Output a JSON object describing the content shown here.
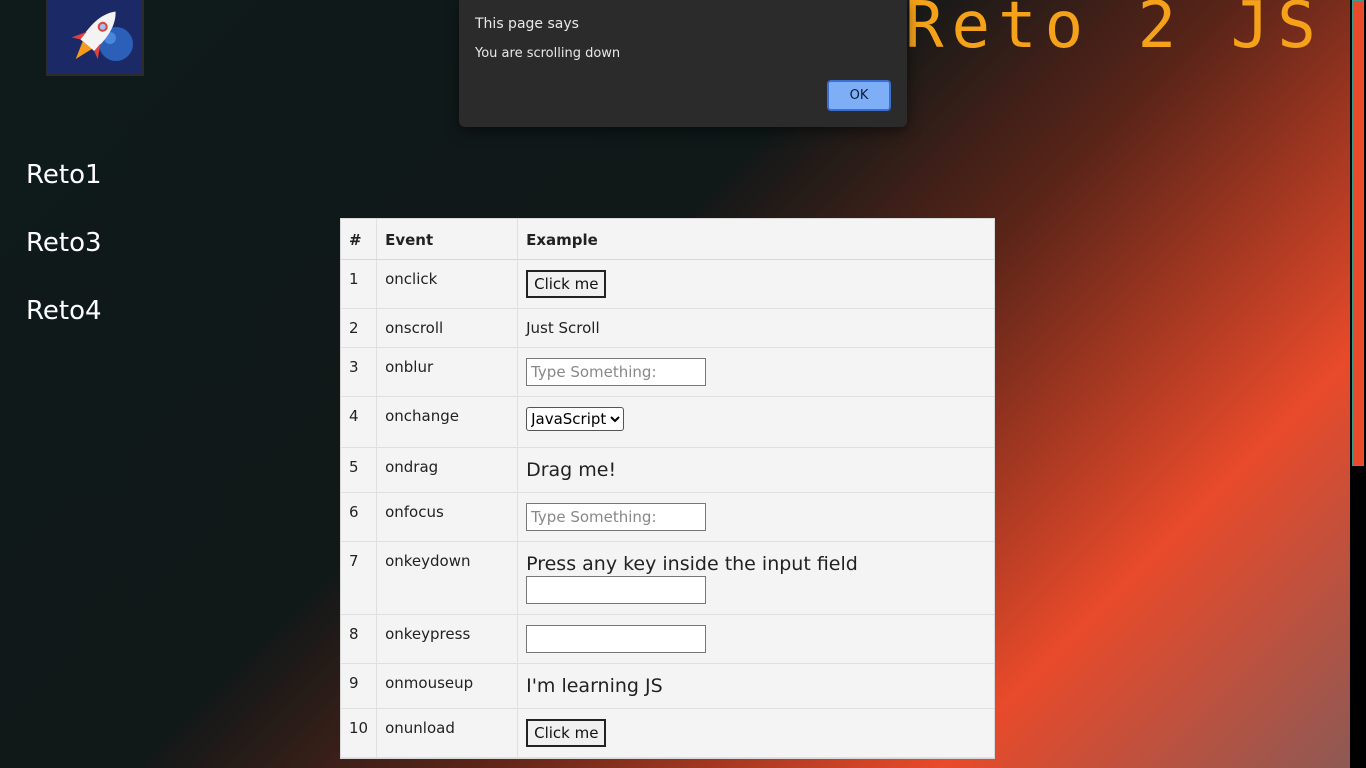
{
  "site": {
    "title": "Reto 2 JS"
  },
  "nav": {
    "items": [
      {
        "label": "Reto1"
      },
      {
        "label": "Reto3"
      },
      {
        "label": "Reto4"
      }
    ]
  },
  "table": {
    "headers": [
      "#",
      "Event",
      "Example"
    ],
    "rows": [
      {
        "n": "1",
        "event": "onclick",
        "button": "Click me"
      },
      {
        "n": "2",
        "event": "onscroll",
        "text": "Just Scroll"
      },
      {
        "n": "3",
        "event": "onblur",
        "placeholder": "Type Something:"
      },
      {
        "n": "4",
        "event": "onchange",
        "select": "JavaScript"
      },
      {
        "n": "5",
        "event": "ondrag",
        "text": "Drag me!"
      },
      {
        "n": "6",
        "event": "onfocus",
        "placeholder": "Type Something:"
      },
      {
        "n": "7",
        "event": "onkeydown",
        "text": "Press any key inside the input field"
      },
      {
        "n": "8",
        "event": "onkeypress"
      },
      {
        "n": "9",
        "event": "onmouseup",
        "text": "I'm learning JS"
      },
      {
        "n": "10",
        "event": "onunload",
        "button": "Click me"
      }
    ]
  },
  "dialog": {
    "title": "This page says",
    "message": "You are scrolling down",
    "ok": "OK"
  },
  "colors": {
    "accent": "#f5a21a",
    "dialog_bg": "#2b2b2b",
    "ok_button": "#7eaef5"
  }
}
